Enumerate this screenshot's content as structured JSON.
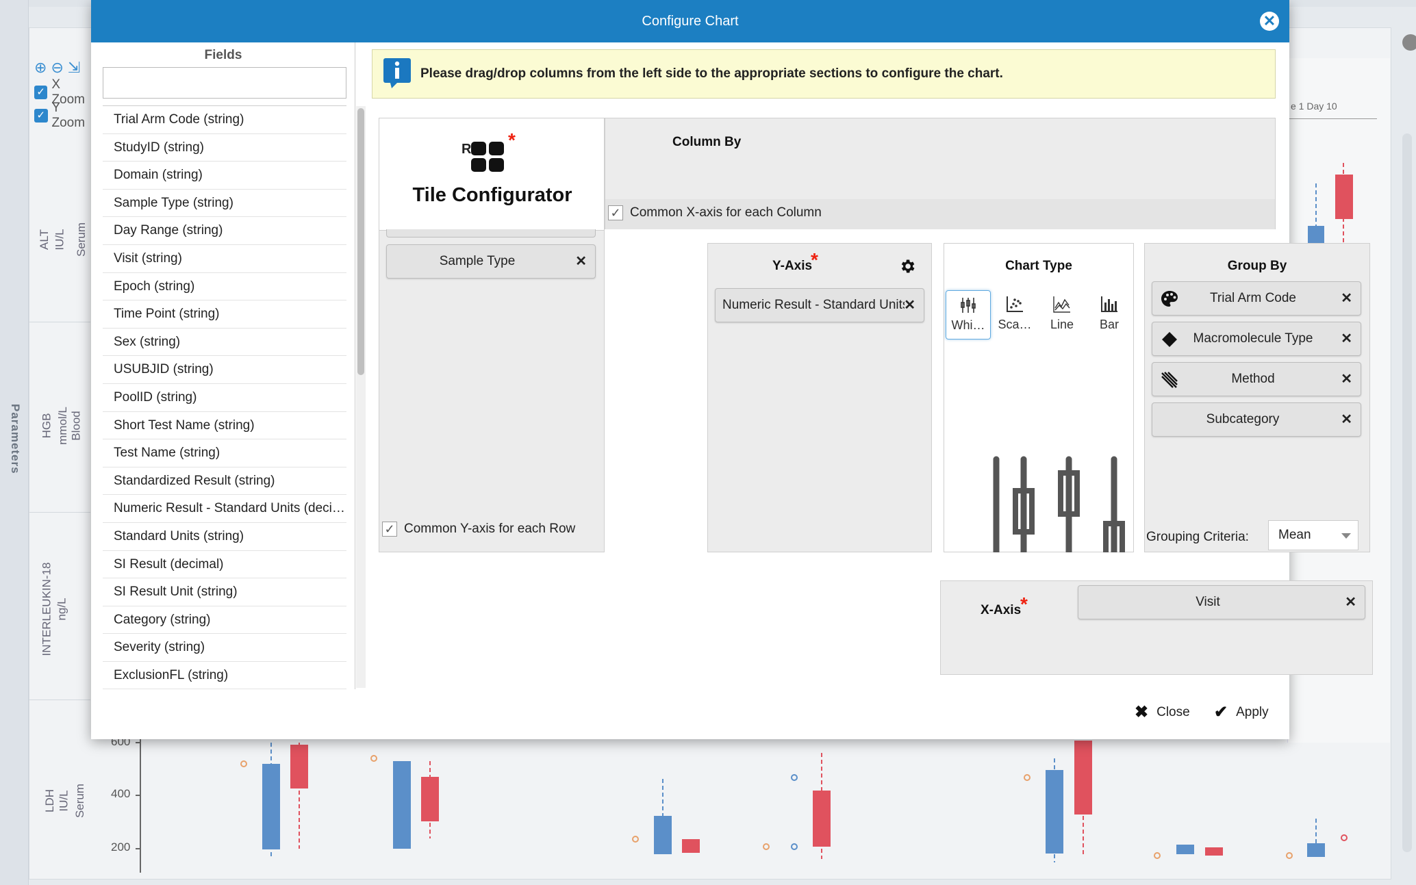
{
  "background": {
    "side_label": "Parameters",
    "zoom": {
      "x_label": "X Zoom",
      "y_label": "Y Zoom"
    },
    "row_labels": [
      {
        "param": "ALT",
        "unit": "IU/L",
        "specimen": "Serum"
      },
      {
        "param": "HGB",
        "unit": "mmol/L",
        "specimen": "Blood"
      },
      {
        "param": "INTERLEUKIN-18",
        "unit": "ng/L",
        "specimen": ""
      },
      {
        "param": "LDH",
        "unit": "IU/L",
        "specimen": "Serum"
      }
    ],
    "y_ticks": [
      "600",
      "400",
      "200"
    ],
    "right_panel_header": "e 1 Day 10"
  },
  "dialog": {
    "title": "Configure Chart",
    "close_icon": "close-circle-icon"
  },
  "fields": {
    "title": "Fields",
    "search_value": "",
    "items": [
      "Trial Arm Code (string)",
      "StudyID (string)",
      "Domain (string)",
      "Sample Type (string)",
      "Day Range (string)",
      "Visit (string)",
      "Epoch (string)",
      "Time Point (string)",
      "Sex (string)",
      "USUBJID (string)",
      "PoolID (string)",
      "Short Test Name (string)",
      "Test Name (string)",
      "Standardized Result (string)",
      "Numeric Result - Standard Units (deci…",
      "Standard Units (string)",
      "SI Result (decimal)",
      "SI Result Unit (string)",
      "Category (string)",
      "Severity (string)",
      "ExclusionFL (string)"
    ]
  },
  "info": {
    "text": "Please drag/drop columns from the left side to the appropriate sections to configure the chart."
  },
  "tile": {
    "title": "Tile Configurator",
    "icon_prefix": "R",
    "required_mark": "*"
  },
  "column_by": {
    "title": "Column By",
    "common_x_label": "Common X-axis for each Column",
    "common_x_checked": true
  },
  "row_by": {
    "pill": "Sample Type",
    "common_y_label": "Common Y-axis for each Row",
    "common_y_checked": true
  },
  "y_axis": {
    "title": "Y-Axis",
    "required_mark": "*",
    "pill": "Numeric Result - Standard Units"
  },
  "chart_type": {
    "title": "Chart Type",
    "options": [
      {
        "label": "Whi…",
        "icon": "whisker-chart-icon",
        "selected": true
      },
      {
        "label": "Sca…",
        "icon": "scatter-chart-icon",
        "selected": false
      },
      {
        "label": "Line",
        "icon": "line-chart-icon",
        "selected": false
      },
      {
        "label": "Bar",
        "icon": "bar-chart-icon",
        "selected": false
      }
    ]
  },
  "group_by": {
    "title": "Group By",
    "pills": [
      {
        "label": "Trial Arm Code",
        "icon": "palette-icon"
      },
      {
        "label": "Macromolecule Type",
        "icon": "diamond-icon"
      },
      {
        "label": "Method",
        "icon": "hatch-pattern-icon"
      },
      {
        "label": "Subcategory",
        "icon": ""
      }
    ],
    "criteria_label": "Grouping Criteria:",
    "criteria_value": "Mean"
  },
  "x_axis": {
    "title": "X-Axis",
    "required_mark": "*",
    "pill": "Visit"
  },
  "footer": {
    "close_label": "Close",
    "apply_label": "Apply"
  },
  "colors": {
    "header_blue": "#1c7fc2",
    "banner_yellow": "#fbfbd3",
    "required_red": "#e21111",
    "box_blue": "#5b8fc9",
    "box_red": "#e0525e"
  }
}
